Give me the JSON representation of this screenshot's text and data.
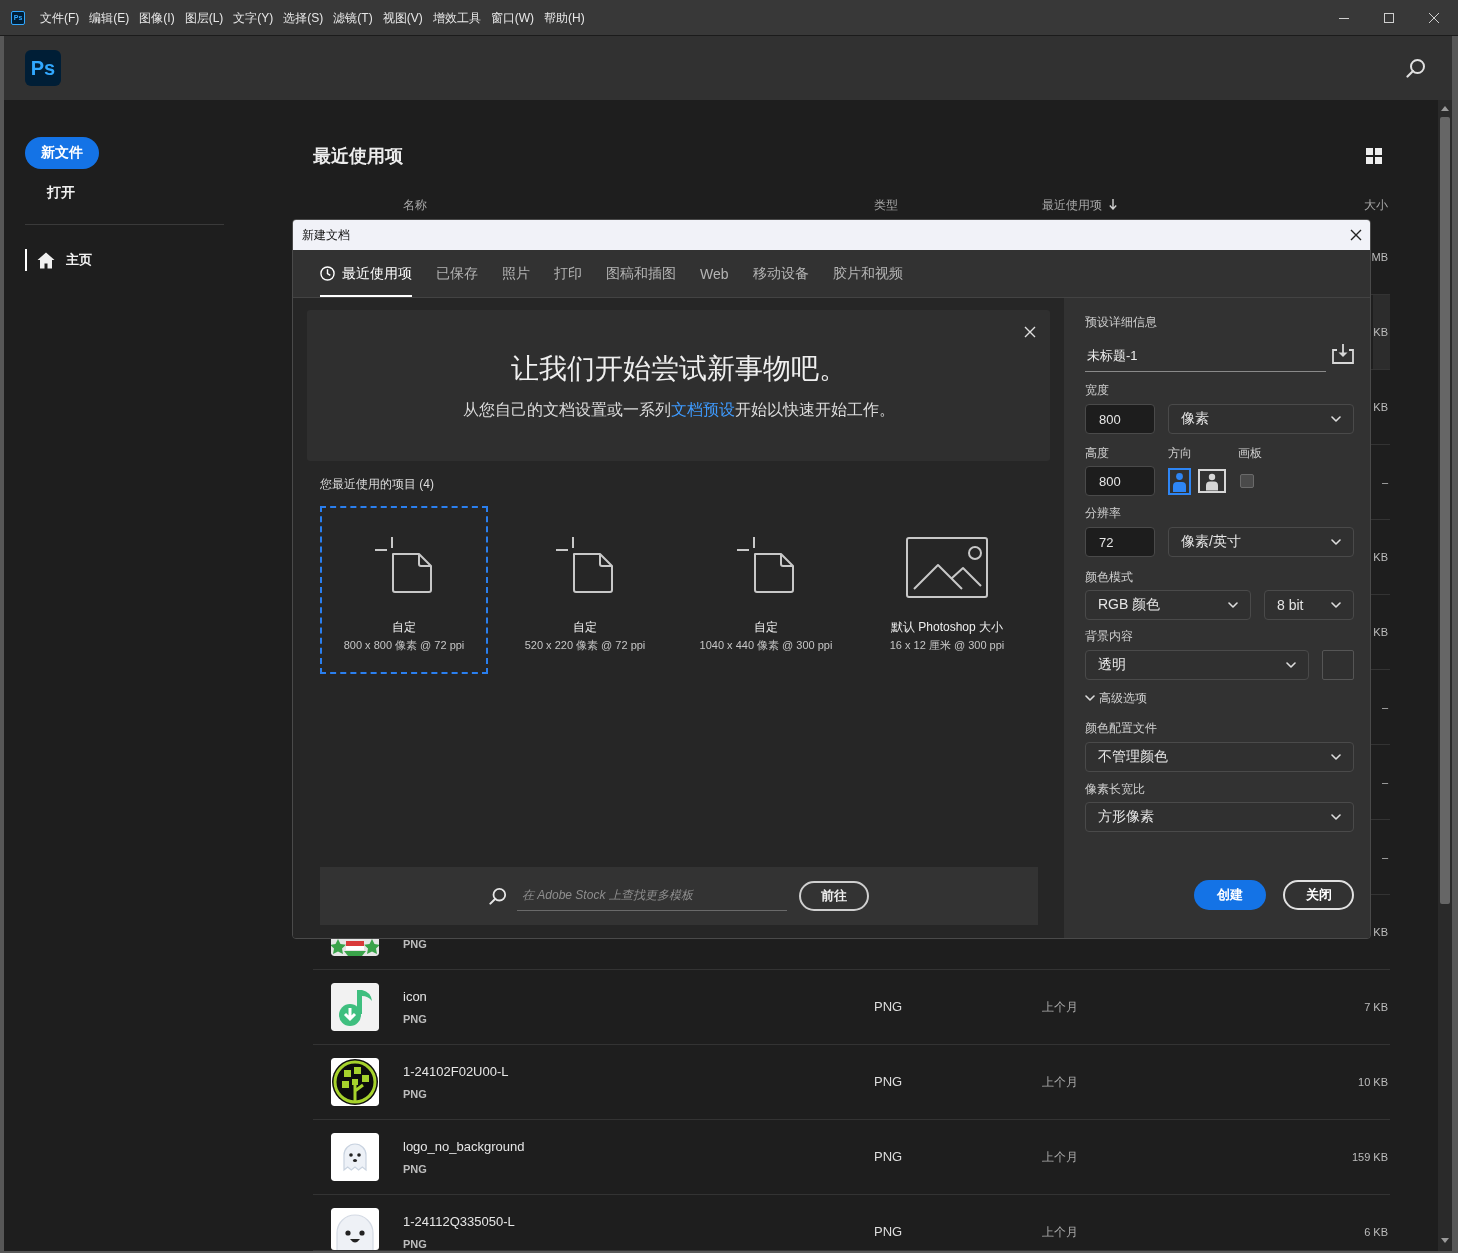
{
  "menu_bar": {
    "app_icon": "Ps",
    "items": [
      "文件(F)",
      "编辑(E)",
      "图像(I)",
      "图层(L)",
      "文字(Y)",
      "选择(S)",
      "滤镜(T)",
      "视图(V)",
      "增效工具",
      "窗口(W)",
      "帮助(H)"
    ]
  },
  "header": {
    "logo": "Ps"
  },
  "sidebar": {
    "new_button": "新文件",
    "open_button": "打开",
    "nav": [
      {
        "label": "主页",
        "selected": true
      }
    ]
  },
  "recent": {
    "title": "最近使用项",
    "columns": [
      {
        "label": "名称",
        "sorted": false
      },
      {
        "label": "类型",
        "sorted": false
      },
      {
        "label": "最近使用项",
        "sorted": true
      },
      {
        "label": "大小",
        "sorted": false
      }
    ],
    "rows": [
      {
        "kind": "covered",
        "size": "MB",
        "selected": false
      },
      {
        "kind": "covered",
        "size": "KB",
        "selected": true
      },
      {
        "kind": "covered",
        "size": "KB",
        "selected": false
      },
      {
        "kind": "covered",
        "size": "–",
        "selected": false
      },
      {
        "kind": "covered",
        "size": "KB",
        "selected": false
      },
      {
        "kind": "covered",
        "size": "KB",
        "selected": false
      },
      {
        "kind": "covered",
        "size": "–",
        "selected": false
      },
      {
        "kind": "covered",
        "size": "–",
        "selected": false
      },
      {
        "kind": "covered",
        "size": "–",
        "selected": false
      },
      {
        "kind": "stars",
        "format": "PNG",
        "size": "KB",
        "selected": false
      },
      {
        "kind": "music",
        "name": "icon",
        "format": "PNG",
        "type": "PNG",
        "modified": "上个月",
        "size": "7 KB",
        "selected": false
      },
      {
        "kind": "tree",
        "name": "1-24102F02U00-L",
        "format": "PNG",
        "type": "PNG",
        "modified": "上个月",
        "size": "10 KB",
        "selected": false
      },
      {
        "kind": "ghost",
        "name": "logo_no_background",
        "format": "PNG",
        "type": "PNG",
        "modified": "上个月",
        "size": "159 KB",
        "selected": false
      },
      {
        "kind": "face",
        "name": "1-24112Q335050-L",
        "format": "PNG",
        "type": "PNG",
        "modified": "上个月",
        "size": "6 KB",
        "selected": false
      }
    ]
  },
  "dialog": {
    "title": "新建文档",
    "tabs": [
      {
        "kind": "history",
        "label": "最近使用项",
        "selected": true
      },
      {
        "kind": "category",
        "label": "已保存",
        "selected": false
      },
      {
        "kind": "category",
        "label": "照片",
        "selected": false
      },
      {
        "kind": "category",
        "label": "打印",
        "selected": false
      },
      {
        "kind": "category",
        "label": "图稿和插图",
        "selected": false
      },
      {
        "kind": "category",
        "label": "Web",
        "selected": false
      },
      {
        "kind": "category",
        "label": "移动设备",
        "selected": false
      },
      {
        "kind": "category",
        "label": "胶片和视频",
        "selected": false
      }
    ],
    "banner": {
      "heading": "让我们开始尝试新事物吧。",
      "text_before": "从您自己的文档设置或一系列",
      "link": "文档预设",
      "text_after": "开始以快速开始工作。"
    },
    "recent_label": "您最近使用的项目 (4)",
    "presets": [
      {
        "kind": "custom",
        "name": "自定",
        "size": "800 x 800 像素 @ 72 ppi",
        "selected": true
      },
      {
        "kind": "custom",
        "name": "自定",
        "size": "520 x 220 像素 @ 72 ppi",
        "selected": false
      },
      {
        "kind": "custom",
        "name": "自定",
        "size": "1040 x 440 像素 @ 300 ppi",
        "selected": false
      },
      {
        "kind": "default",
        "name": "默认 Photoshop 大小",
        "size": "16 x 12 厘米 @ 300 ppi",
        "selected": false
      }
    ],
    "stock": {
      "placeholder": "在 Adobe Stock 上查找更多模板",
      "button": "前往"
    },
    "details": {
      "title": "预设详细信息",
      "name": "未标题-1",
      "width": {
        "label": "宽度",
        "value": "800",
        "unit": "像素"
      },
      "height": {
        "label": "高度",
        "value": "800"
      },
      "orientation": {
        "label": "方向",
        "options": [
          {
            "kind": "portrait",
            "selected": true
          },
          {
            "kind": "landscape",
            "selected": false
          }
        ]
      },
      "artboard": {
        "label": "画板",
        "checked": false
      },
      "resolution": {
        "label": "分辨率",
        "value": "72",
        "unit": "像素/英寸"
      },
      "color_mode": {
        "label": "颜色模式",
        "value": "RGB 颜色",
        "depth": "8 bit"
      },
      "background": {
        "label": "背景内容",
        "value": "透明"
      },
      "advanced": {
        "label": "高级选项",
        "expanded": true
      },
      "color_profile": {
        "label": "颜色配置文件",
        "value": "不管理颜色"
      },
      "pixel_aspect": {
        "label": "像素长宽比",
        "value": "方形像素"
      }
    },
    "buttons": [
      {
        "kind": "primary",
        "label": "创建"
      },
      {
        "kind": "secondary",
        "label": "关闭"
      }
    ]
  }
}
